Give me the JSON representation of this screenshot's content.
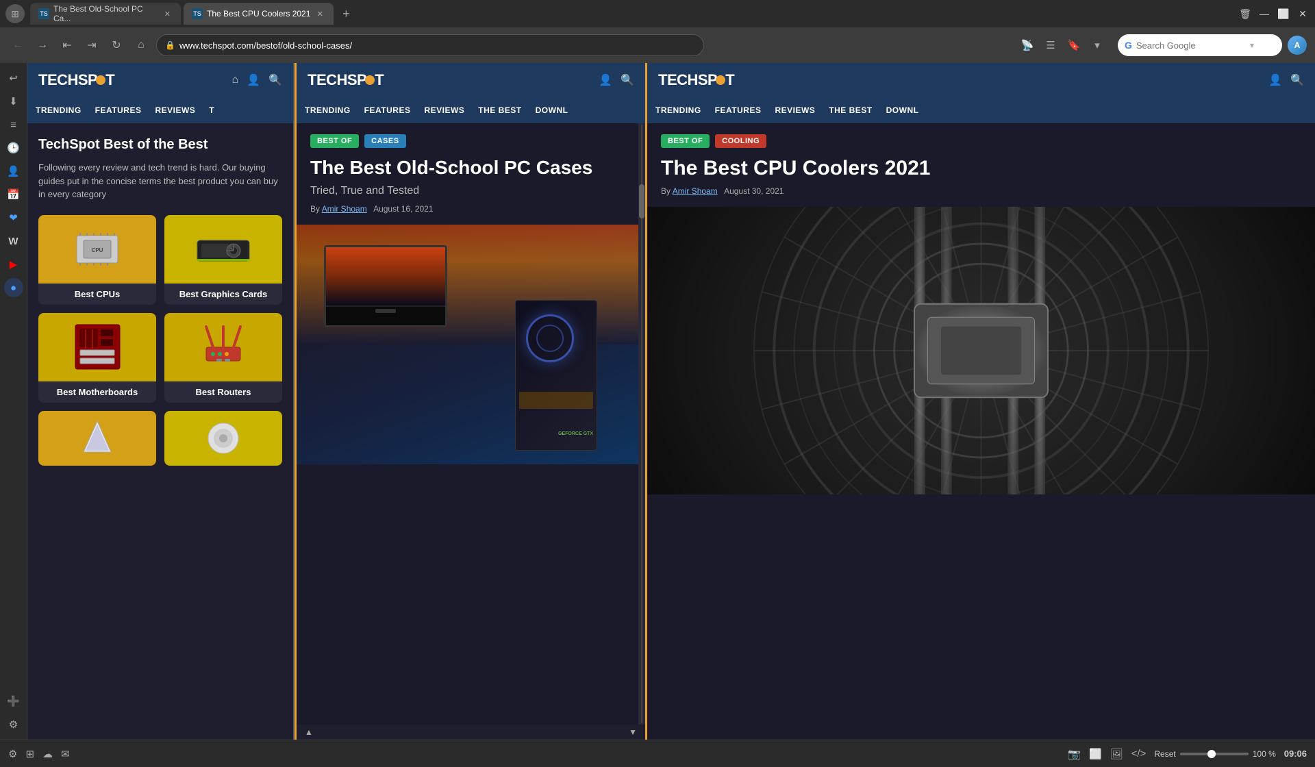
{
  "browser": {
    "tabs": [
      {
        "id": "tab1",
        "title": "The Best Old-School PC Ca...",
        "favicon": "TS",
        "active": false,
        "url": "www.techspot.com/bestof/old-school-cases/"
      },
      {
        "id": "tab2",
        "title": "The Best CPU Coolers 2021",
        "favicon": "TS",
        "active": true
      },
      {
        "id": "newtab",
        "label": "+"
      }
    ],
    "url": "www.techspot.com/bestof/old-school-cases/",
    "search_placeholder": "Search Google",
    "win_controls": [
      "🗑",
      "—",
      "⬜",
      "✕"
    ]
  },
  "sidebar": {
    "icons": [
      "↩",
      "⬇",
      "📋",
      "🕒",
      "👤",
      "📅",
      "❤",
      "W",
      "▶",
      "🔵",
      "➕"
    ]
  },
  "left_panel": {
    "header": {
      "logo": "TECHSPOT",
      "nav_items": [
        "TRENDING",
        "FEATURES",
        "REVIEWS",
        "T"
      ]
    },
    "title": "TechSpot Best of the Best",
    "subtitle": "Following every review and tech trend is hard. Our buying guides put in the concise terms the best product you can buy in every category",
    "cards": [
      {
        "label": "Best CPUs",
        "bg": "cpu-bg",
        "icon": "🖥"
      },
      {
        "label": "Best Graphics Cards",
        "bg": "gpu-bg",
        "icon": "🎮"
      },
      {
        "label": "Best Motherboards",
        "bg": "mb-bg",
        "icon": "🔌"
      },
      {
        "label": "Best Routers",
        "bg": "router-bg",
        "icon": "📡"
      }
    ],
    "bottom_cards": [
      {
        "label": "",
        "bg": "cpu-bg",
        "icon": "💡"
      },
      {
        "label": "",
        "bg": "gpu-bg",
        "icon": "💿"
      }
    ]
  },
  "center_panel": {
    "header": {
      "logo": "TECHSPOT",
      "nav_items": [
        "TRENDING",
        "FEATURES",
        "REVIEWS",
        "THE BEST",
        "DOWNL"
      ]
    },
    "badges": [
      "BEST OF",
      "CASES"
    ],
    "article_title": "The Best Old-School PC Cases",
    "article_subtitle": "Tried, True and Tested",
    "author": "Amir Shoam",
    "date": "August 16, 2021",
    "by_label": "By"
  },
  "right_panel": {
    "header": {
      "logo": "TECHSPOT",
      "nav_items": [
        "TRENDING",
        "FEATURES",
        "REVIEWS",
        "THE BEST",
        "DOWNL"
      ]
    },
    "badges": [
      "BEST OF",
      "COOLING"
    ],
    "article_title": "The Best CPU Coolers 2021",
    "author": "Amir Shoam",
    "date": "August 30, 2021",
    "by_label": "By"
  },
  "status_bar": {
    "reset_label": "Reset",
    "zoom_level": "100 %",
    "time": "09:06"
  }
}
